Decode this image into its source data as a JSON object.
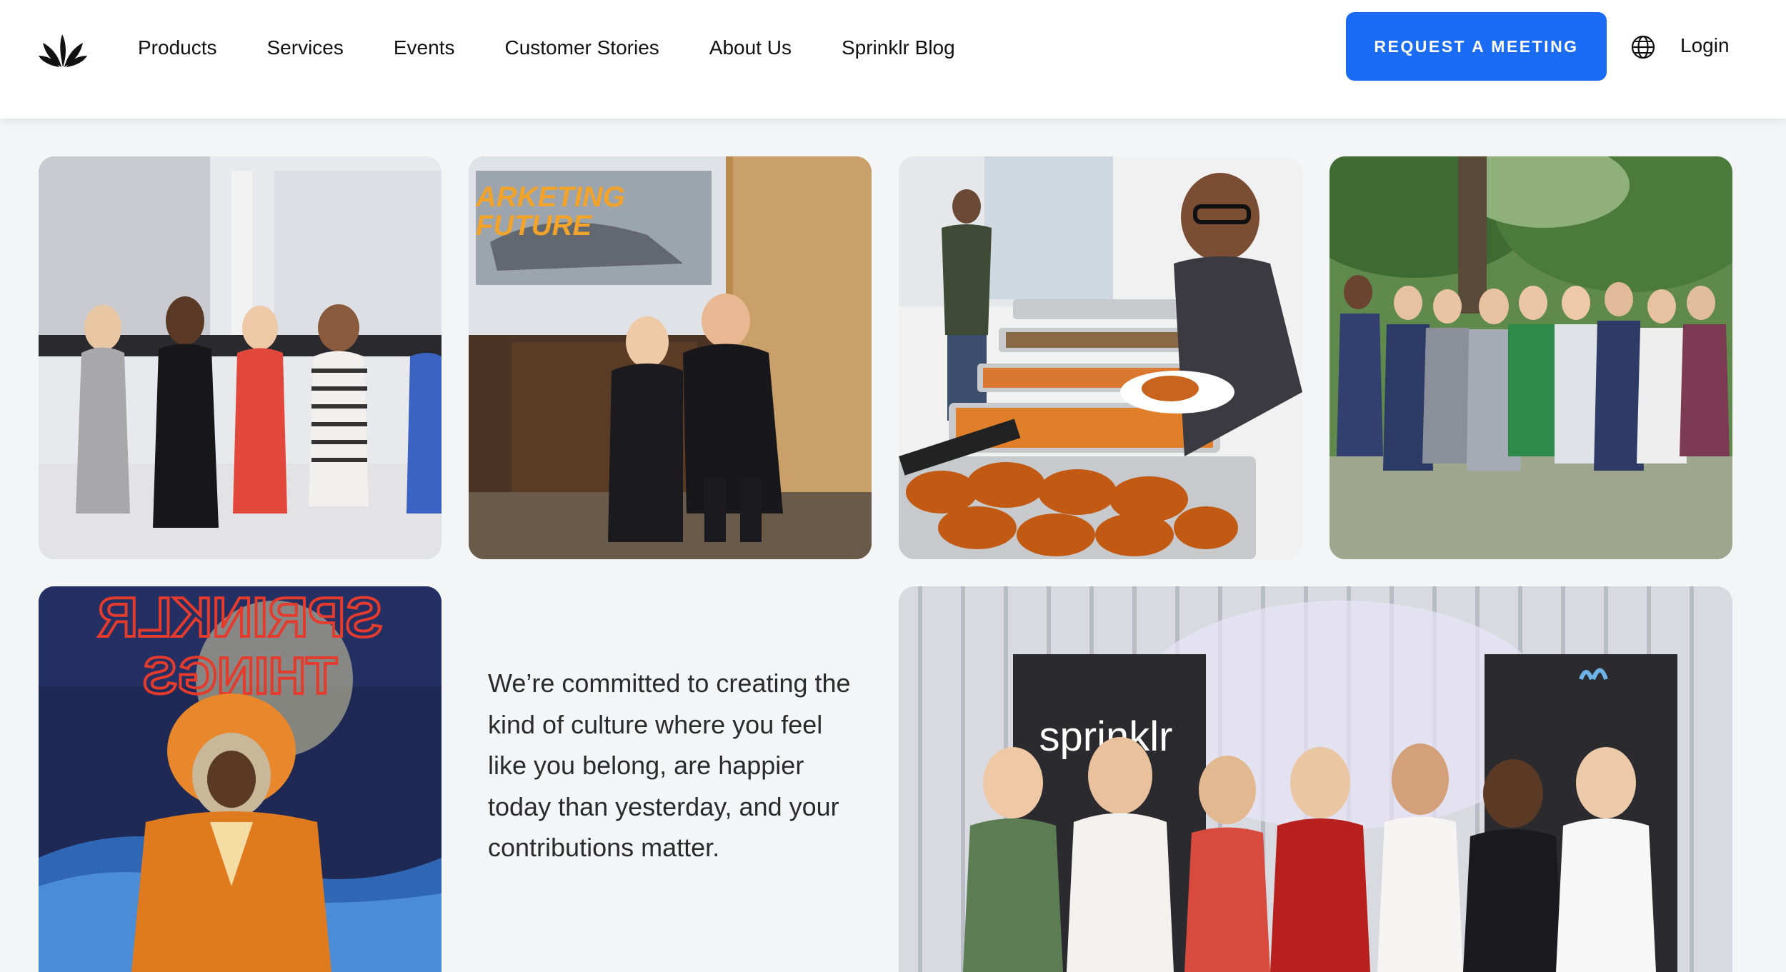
{
  "nav": {
    "links": [
      "Products",
      "Services",
      "Events",
      "Customer Stories",
      "About Us",
      "Sprinklr Blog"
    ],
    "cta_label": "REQUEST A MEETING",
    "login_label": "Login",
    "accent_color": "#1a6cf5",
    "icons": [
      "sprinklr-logo",
      "globe-icon"
    ]
  },
  "gallery": {
    "photos": [
      {
        "subject": "group-of-women-photo"
      },
      {
        "subject": "two-presenters-photo"
      },
      {
        "subject": "food-buffet-photo"
      },
      {
        "subject": "volunteer-group-photo"
      },
      {
        "subject": "costume-event-photo"
      },
      {
        "subject": "women-at-sprinklr-event-photo"
      }
    ],
    "culture_text": "We’re committed to creating the kind of culture where you feel like you belong, are happier today than yesterday, and your contributions matter.",
    "backdrop_logo": "sprinklr"
  }
}
